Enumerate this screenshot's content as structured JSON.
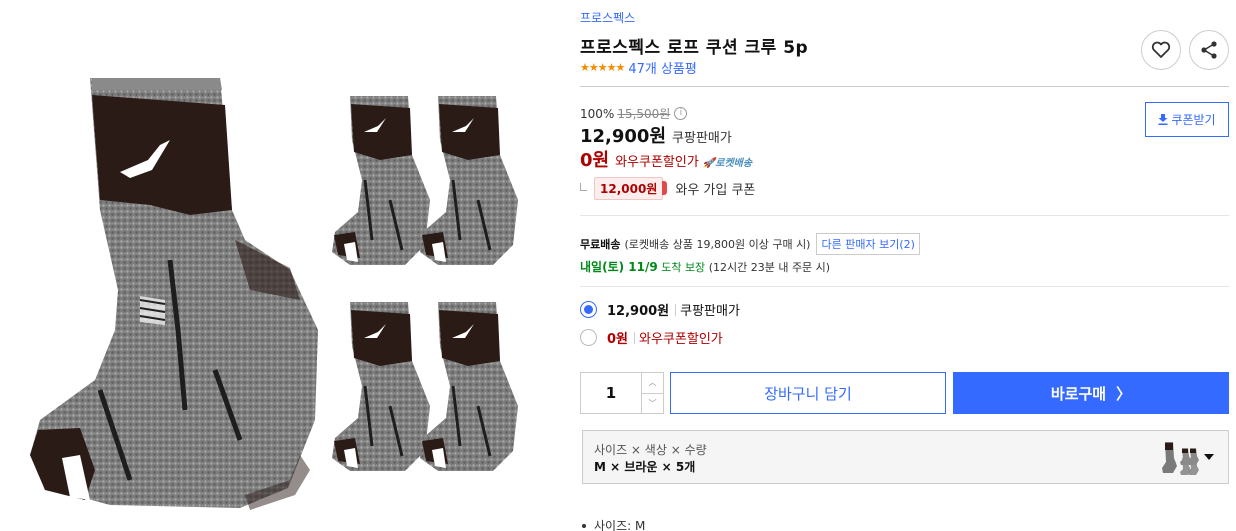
{
  "product": {
    "brand": "프로스펙스",
    "title": "프로스펙스 로프 쿠션 크루 5p",
    "rating_stars": "★★★★★",
    "review_count": "47개 상품평"
  },
  "actions": {
    "wishlist_icon": "heart-icon",
    "share_icon": "share-icon",
    "coupon_download_label": "쿠폰받기"
  },
  "pricing": {
    "discount_rate": "100%",
    "original_price": "15,500원",
    "sale_price": "12,900원",
    "sale_label": "쿠팡판매가",
    "wow_price": "0원",
    "wow_label": "와우쿠폰할인가",
    "rocket_label": "로켓배송",
    "join_coupon_amount": "12,000원",
    "join_coupon_label": "와우 가입 쿠폰"
  },
  "shipping": {
    "free_label": "무료배송",
    "condition": "(로켓배송 상품 19,800원 이상 구매 시)",
    "other_sellers": "다른 판매자 보기(2)",
    "arrival_date": "내일(토) 11/9",
    "arrival_suffix": "도착 보장",
    "arrival_note": "(12시간 23분 내 주문 시)"
  },
  "price_options": [
    {
      "price": "12,900원",
      "label": "쿠팡판매가",
      "selected": true
    },
    {
      "price": "0원",
      "label": "와우쿠폰할인가",
      "selected": false
    }
  ],
  "purchase": {
    "quantity": "1",
    "cart_label": "장바구니 담기",
    "buy_label": "바로구매",
    "buy_arrow": "〉"
  },
  "variant": {
    "header": "사이즈 × 색상 × 수량",
    "value": "M × 브라운 × 5개"
  },
  "details": {
    "first_item": "사이즈: M"
  },
  "colors": {
    "accent": "#346aff",
    "price_red": "#ae0000",
    "arrival_green": "#00891a",
    "star_orange": "#f28b00"
  }
}
